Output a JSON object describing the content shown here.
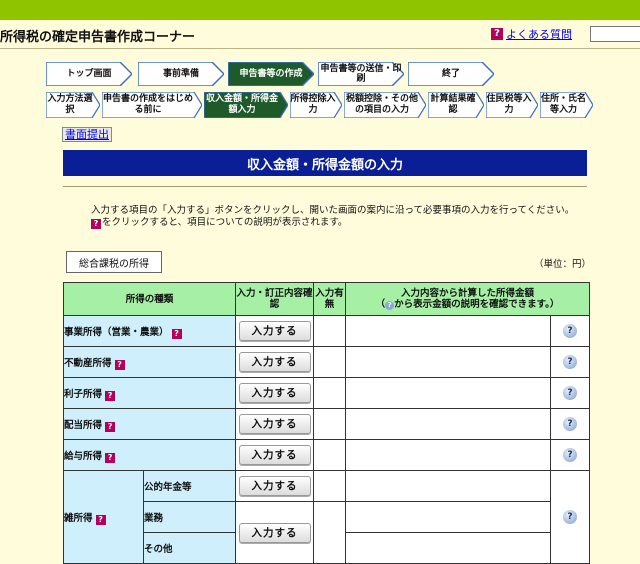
{
  "header": {
    "site_title": "所得税の確定申告書作成コーナー",
    "faq_label": "よくある質問",
    "faq_icon": "question-icon"
  },
  "steps": [
    {
      "label": "トップ画面"
    },
    {
      "label": "事前準備"
    },
    {
      "label": "申告書等の作成",
      "active": true
    },
    {
      "label": "申告書等の送信・印刷"
    },
    {
      "label": "終了"
    }
  ],
  "substeps": [
    {
      "label": "入力方法選択"
    },
    {
      "label": "申告書の作成をはじめる前に"
    },
    {
      "label": "収入金額・所得金額入力",
      "active": true
    },
    {
      "label": "所得控除入力"
    },
    {
      "label": "税額控除・その他の項目の入力"
    },
    {
      "label": "計算結果確認"
    },
    {
      "label": "住民税等入力"
    },
    {
      "label": "住所・氏名等入力"
    }
  ],
  "submit_button": "書面提出",
  "page_title": "収入金額・所得金額の入力",
  "instructions": {
    "line1": "入力する項目の「入力する」ボタンをクリックし、開いた画面の案内に沿って必要事項の入力を行ってください。",
    "line2": "をクリックすると、項目についての説明が表示されます。"
  },
  "section_label": "総合課税の所得",
  "unit_label": "（単位：円）",
  "table": {
    "headers": {
      "type": "所得の種類",
      "input": "入力・訂正内容確認",
      "has_input": "入力有無",
      "calc_line1": "入力内容から計算した所得金額",
      "calc_line2_pre": "（",
      "calc_line2_post": "から表示金額の説明を確認できます。）"
    },
    "input_button": "入力する",
    "rows": [
      {
        "name": "事業所得（営業・農業）"
      },
      {
        "name": "不動産所得"
      },
      {
        "name": "利子所得"
      },
      {
        "name": "配当所得"
      },
      {
        "name": "給与所得"
      }
    ],
    "misc": {
      "name": "雑所得",
      "subs": [
        "公的年金等",
        "業務",
        "その他"
      ]
    }
  },
  "colors": {
    "top_stripe": "#8fc400",
    "background": "#fffcdb",
    "title_bar": "#0a1e96",
    "table_header": "#a6f0a6",
    "category_cell": "#cfeffd",
    "active_step": "#1f5a2a",
    "question_mark": "#b3005f"
  }
}
